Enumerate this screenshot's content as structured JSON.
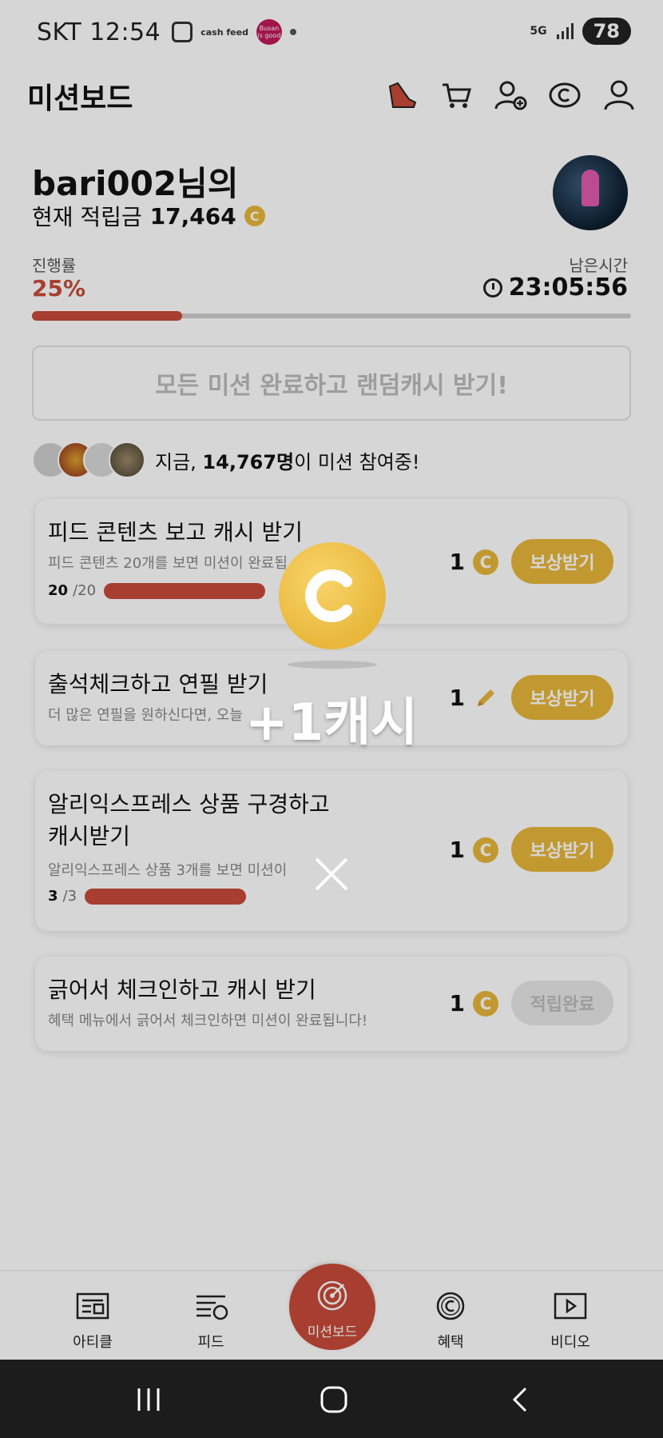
{
  "status_bar": {
    "carrier": "SKT",
    "time": "12:54",
    "cash_icon_text": "cash feed",
    "busan_icon_text": "Busan is good",
    "network": "5G",
    "battery": "78"
  },
  "header": {
    "title": "미션보드",
    "icons": [
      "shoe-icon",
      "cart-icon",
      "add-friend-icon",
      "cash-icon",
      "profile-icon"
    ]
  },
  "profile": {
    "name": "bari002님의",
    "balance_label": "현재 적립금",
    "balance_value": "17,464",
    "coin_symbol": "C"
  },
  "progress": {
    "label": "진행률",
    "percent_text": "25%",
    "percent_value": 0.25,
    "remaining_label": "남은시간",
    "remaining_time": "23:05:56"
  },
  "all_complete_button": "모든 미션 완료하고 랜덤캐시 받기!",
  "participants": {
    "prefix": "지금, ",
    "count": "14,767명",
    "suffix": "이 미션 참여중!"
  },
  "missions": [
    {
      "title": "피드 콘텐츠 보고 캐시 받기",
      "desc": "피드 콘텐츠 20개를 보면 미션이 완료됩",
      "progress_done": "20",
      "progress_total": "/20",
      "progress_value": 1.0,
      "reward": "1",
      "reward_icon": "coin-icon",
      "button": "보상받기"
    },
    {
      "title": "출석체크하고 연필 받기",
      "desc": "더 많은 연필을 원하신다면, 오늘",
      "reward": "1",
      "reward_icon": "pencil-icon",
      "button": "보상받기"
    },
    {
      "title_line1": "알리익스프레스 상품 구경하고",
      "title_line2": "캐시받기",
      "desc": "알리익스프레스 상품 3개를 보면 미션이",
      "desc_tail": "!",
      "progress_done": "3",
      "progress_total": "/3",
      "progress_value": 1.0,
      "reward": "1",
      "reward_icon": "coin-icon",
      "button": "보상받기"
    },
    {
      "title": "긁어서 체크인하고 캐시 받기",
      "desc": "혜택 메뉴에서 긁어서 체크인하면 미션이 완료됩니다!",
      "reward": "1",
      "reward_icon": "coin-icon",
      "button": "적립완료"
    }
  ],
  "bottom_nav": {
    "items": [
      "아티클",
      "피드",
      "미션보드",
      "혜택",
      "비디오"
    ]
  },
  "overlay": {
    "coin_symbol": "C",
    "reward_text": "+1캐시"
  },
  "colors": {
    "accent_red": "#c84a3a",
    "coin_gold": "#e8b73b",
    "overlay_dim": "rgba(0,0,0,0.16)"
  }
}
